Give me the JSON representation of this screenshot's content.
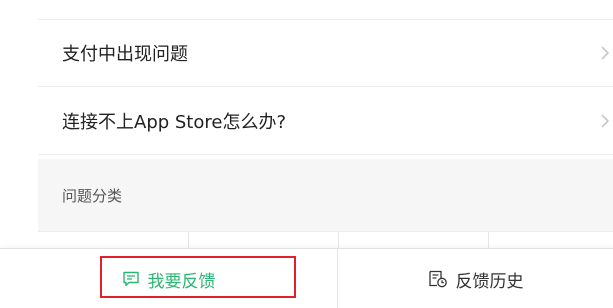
{
  "faq": {
    "items": [
      {
        "label": "支付中出现问题"
      },
      {
        "label": "连接不上App Store怎么办?"
      }
    ]
  },
  "section": {
    "title": "问题分类"
  },
  "bottom_bar": {
    "feedback_label": "我要反馈",
    "history_label": "反馈历史"
  },
  "icons": {
    "feedback": "message-square-icon",
    "history": "history-document-icon",
    "chevron": "chevron-right-icon"
  },
  "colors": {
    "accent": "#2bb673",
    "highlight": "#e0202a",
    "section_bg": "#f6f6f6",
    "text": "#222222",
    "chevron": "#c7c7c7"
  }
}
